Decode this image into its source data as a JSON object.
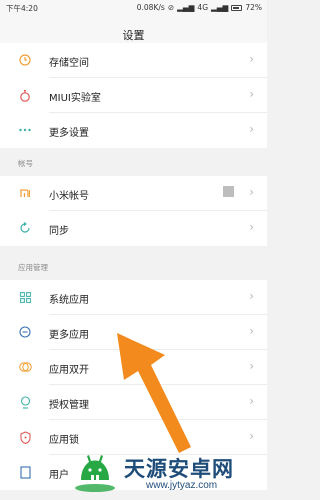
{
  "status_bar": {
    "time": "下午4:20",
    "speed": "0.08K/s",
    "network": "4G",
    "battery": "72%"
  },
  "header": {
    "title": "设置"
  },
  "group_top": {
    "items": [
      {
        "label": "存储空间",
        "icon": "clock-icon"
      },
      {
        "label": "MIUI实验室",
        "icon": "flask-icon"
      },
      {
        "label": "更多设置",
        "icon": "more-dots-icon"
      }
    ]
  },
  "section_account": {
    "title": "帐号",
    "items": [
      {
        "label": "小米帐号",
        "icon": "mi-logo-icon"
      },
      {
        "label": "同步",
        "icon": "sync-icon"
      }
    ]
  },
  "section_apps": {
    "title": "应用管理",
    "items": [
      {
        "label": "系统应用",
        "icon": "grid-icon"
      },
      {
        "label": "更多应用",
        "icon": "more-apps-icon"
      },
      {
        "label": "应用双开",
        "icon": "dual-apps-icon"
      },
      {
        "label": "授权管理",
        "icon": "permission-icon"
      },
      {
        "label": "应用锁",
        "icon": "shield-lock-icon"
      },
      {
        "label": "用户",
        "icon": "user-icon"
      }
    ]
  },
  "chevron": "›",
  "watermark": {
    "title": "天源安卓网",
    "url": "www.jytyaz.com"
  },
  "colors": {
    "accent_orange": "#f28a1e",
    "icon_orange": "#f2a03a",
    "icon_teal": "#3ab0a6",
    "icon_red": "#e05a5a",
    "watermark_green": "#27a845",
    "watermark_blue": "#1f4d7a"
  }
}
